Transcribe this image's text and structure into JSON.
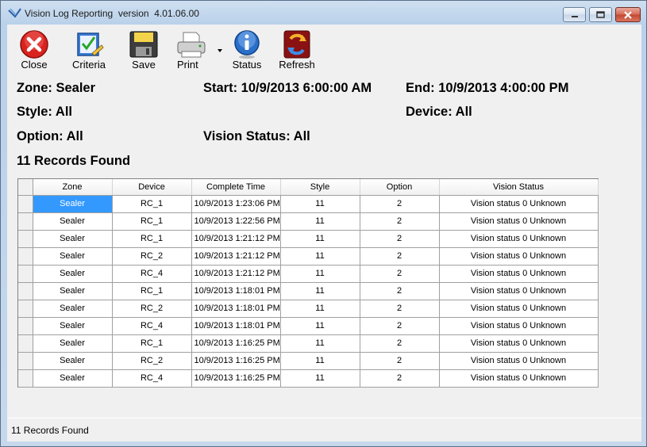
{
  "window": {
    "title": "Vision Log Reporting  version  4.01.06.00"
  },
  "toolbar": {
    "buttons": [
      {
        "label": "Close",
        "icon": "close-icon"
      },
      {
        "label": "Criteria",
        "icon": "criteria-icon"
      },
      {
        "label": "Save",
        "icon": "floppy-disk-icon"
      },
      {
        "label": "Print",
        "icon": "printer-icon"
      },
      {
        "label": "Status",
        "icon": "info-icon"
      },
      {
        "label": "Refresh",
        "icon": "refresh-icon"
      }
    ]
  },
  "filters": {
    "zone": "Zone: Sealer",
    "start": "Start: 10/9/2013 6:00:00 AM",
    "end": "End: 10/9/2013 4:00:00 PM",
    "style": "Style: All",
    "device": "Device: All",
    "option": "Option: All",
    "vision_status": "Vision Status: All",
    "records_found": "11 Records Found"
  },
  "grid": {
    "columns": [
      "Zone",
      "Device",
      "Complete Time",
      "Style",
      "Option",
      "Vision Status"
    ],
    "rows": [
      [
        "Sealer",
        "RC_1",
        "10/9/2013 1:23:06 PM",
        "11",
        "2",
        "Vision status 0 Unknown"
      ],
      [
        "Sealer",
        "RC_1",
        "10/9/2013 1:22:56 PM",
        "11",
        "2",
        "Vision status 0 Unknown"
      ],
      [
        "Sealer",
        "RC_1",
        "10/9/2013 1:21:12 PM",
        "11",
        "2",
        "Vision status 0 Unknown"
      ],
      [
        "Sealer",
        "RC_2",
        "10/9/2013 1:21:12 PM",
        "11",
        "2",
        "Vision status 0 Unknown"
      ],
      [
        "Sealer",
        "RC_4",
        "10/9/2013 1:21:12 PM",
        "11",
        "2",
        "Vision status 0 Unknown"
      ],
      [
        "Sealer",
        "RC_1",
        "10/9/2013 1:18:01 PM",
        "11",
        "2",
        "Vision status 0 Unknown"
      ],
      [
        "Sealer",
        "RC_2",
        "10/9/2013 1:18:01 PM",
        "11",
        "2",
        "Vision status 0 Unknown"
      ],
      [
        "Sealer",
        "RC_4",
        "10/9/2013 1:18:01 PM",
        "11",
        "2",
        "Vision status 0 Unknown"
      ],
      [
        "Sealer",
        "RC_1",
        "10/9/2013 1:16:25 PM",
        "11",
        "2",
        "Vision status 0 Unknown"
      ],
      [
        "Sealer",
        "RC_2",
        "10/9/2013 1:16:25 PM",
        "11",
        "2",
        "Vision status 0 Unknown"
      ],
      [
        "Sealer",
        "RC_4",
        "10/9/2013 1:16:25 PM",
        "11",
        "2",
        "Vision status 0 Unknown"
      ]
    ]
  },
  "statusbar": {
    "text": "11 Records Found"
  },
  "colors": {
    "selection": "#3399ff",
    "close_red": "#d9231f",
    "info_blue": "#2a6fc9"
  }
}
